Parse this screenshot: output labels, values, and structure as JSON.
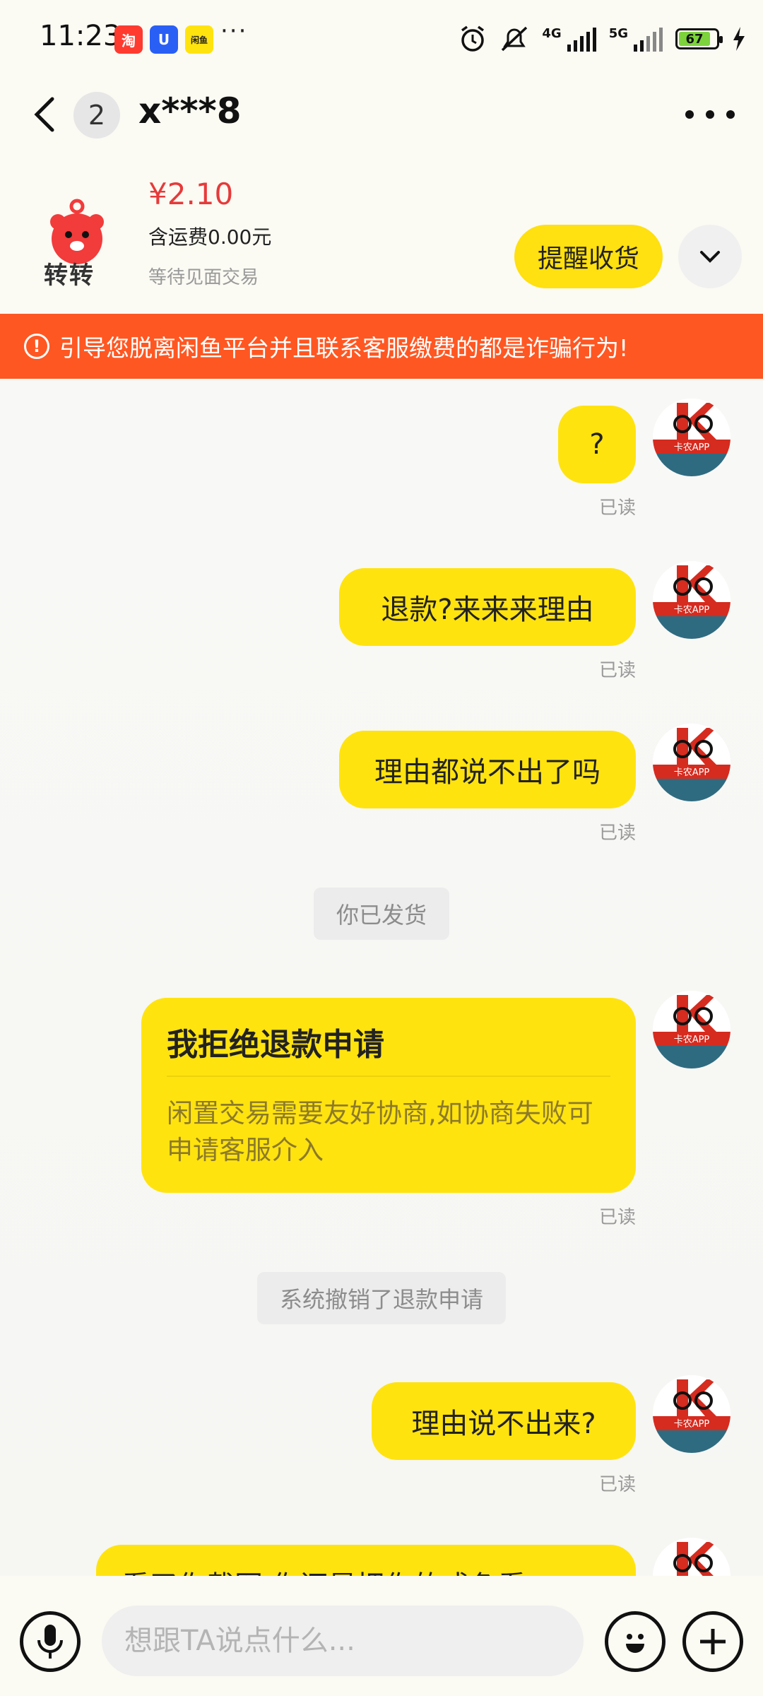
{
  "status_bar": {
    "time": "11:23",
    "apps": [
      "淘",
      "U",
      "闲鱼"
    ],
    "more": "···",
    "network_1": "4G",
    "network_2": "5G",
    "battery": "67"
  },
  "header": {
    "unread_count": "2",
    "title": "x***8"
  },
  "product": {
    "logo_text": "转转",
    "price": "¥2.10",
    "shipping": "含运费0.00元",
    "status": "等待见面交易",
    "remind_button": "提醒收货"
  },
  "warning": {
    "icon": "!",
    "text": "引导您脱离闲鱼平台并且联系客服缴费的都是诈骗行为!"
  },
  "messages": [
    {
      "text": "?",
      "read": "已读"
    },
    {
      "text": "退款?来来来理由",
      "read": "已读"
    },
    {
      "text": "理由都说不出了吗",
      "read": "已读"
    },
    {
      "system": "你已发货"
    },
    {
      "card_title": "我拒绝退款申请",
      "card_body": "闲置交易需要友好协商,如协商失败可申请客服介入",
      "read": "已读"
    },
    {
      "system": "系统撤销了退款申请"
    },
    {
      "text": "理由说不出来?",
      "read": "已读"
    },
    {
      "text": "看了你截图,你还是把你的成色看"
    }
  ],
  "avatar_label": "卡农APP",
  "input": {
    "placeholder": "想跟TA说点什么..."
  },
  "colors": {
    "bubble": "#ffe30f",
    "warning": "#ff5722",
    "price": "#e63a3a"
  }
}
